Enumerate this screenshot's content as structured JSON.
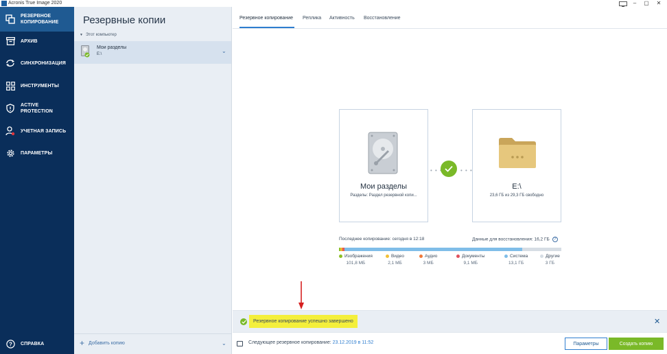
{
  "window": {
    "title": "Acronis True Image 2020",
    "controls": [
      "–",
      "▢",
      "✕"
    ]
  },
  "sidebar": {
    "items": [
      {
        "label": "РЕЗЕРВНОЕ КОПИРОВАНИЕ",
        "icon": "backup-copy-icon",
        "active": true
      },
      {
        "label": "АРХИВ",
        "icon": "archive-icon"
      },
      {
        "label": "СИНХРОНИЗАЦИЯ",
        "icon": "sync-icon"
      },
      {
        "label": "ИНСТРУМЕНТЫ",
        "icon": "tools-grid-icon"
      },
      {
        "label": "ACTIVE PROTECTION",
        "icon": "shield-icon"
      },
      {
        "label": "УЧЕТНАЯ ЗАПИСЬ",
        "icon": "user-icon"
      },
      {
        "label": "ПАРАМЕТРЫ",
        "icon": "gear-icon"
      }
    ],
    "help": {
      "label": "СПРАВКА",
      "icon": "help-icon"
    }
  },
  "backup_list": {
    "title": "Резервные копии",
    "group": "Этот компьютер",
    "items": [
      {
        "name": "Мои разделы",
        "destination": "E:\\"
      }
    ],
    "add_label": "Добавить копию"
  },
  "tabs": [
    {
      "label": "Резервное копирование",
      "active": true
    },
    {
      "label": "Реплика"
    },
    {
      "label": "Активность"
    },
    {
      "label": "Восстановление"
    }
  ],
  "source": {
    "title": "Мои разделы",
    "subtitle": "Разделы: Раздел резервной копи..."
  },
  "destination": {
    "title": "E:\\",
    "subtitle": "23,6 ГБ из 29,3 ГБ свободно"
  },
  "stats": {
    "last_backup": "Последнее копирование: сегодня в 12:18",
    "recovery_data": "Данные для восстановления: 16,2 ГБ",
    "help": "?"
  },
  "usage": {
    "segments": [
      {
        "name": "Изображения",
        "size": "101,8 МБ",
        "color": "#8cbf26",
        "fraction": 0.006
      },
      {
        "name": "Видео",
        "size": "2,1 МБ",
        "color": "#f2c037",
        "fraction": 0.002
      },
      {
        "name": "Аудио",
        "size": "3 МБ",
        "color": "#f07a3a",
        "fraction": 0.002
      },
      {
        "name": "Документы",
        "size": "9,1 МБ",
        "color": "#e0525d",
        "fraction": 0.003
      },
      {
        "name": "Система",
        "size": "13,1 ГБ",
        "color": "#7fbde8",
        "fraction": 0.81
      },
      {
        "name": "Другие",
        "size": "3 ГБ",
        "color": "#d6dde4",
        "fraction": 0.18
      }
    ]
  },
  "notification": {
    "message": "Резервное копирование успешно завершено"
  },
  "footer": {
    "next_label": "Следующее резервное копирование:",
    "next_date": "23.12.2019 в 11:52",
    "params_button": "Параметры",
    "create_button": "Создать копию"
  },
  "colors": {
    "sidebar_bg": "#0a2e5a",
    "sidebar_active": "#1f5a92",
    "accent_blue": "#2e7dcf",
    "success_green": "#7ab928",
    "highlight_yellow": "#f4ef3b",
    "annotation_red": "#d62020"
  }
}
